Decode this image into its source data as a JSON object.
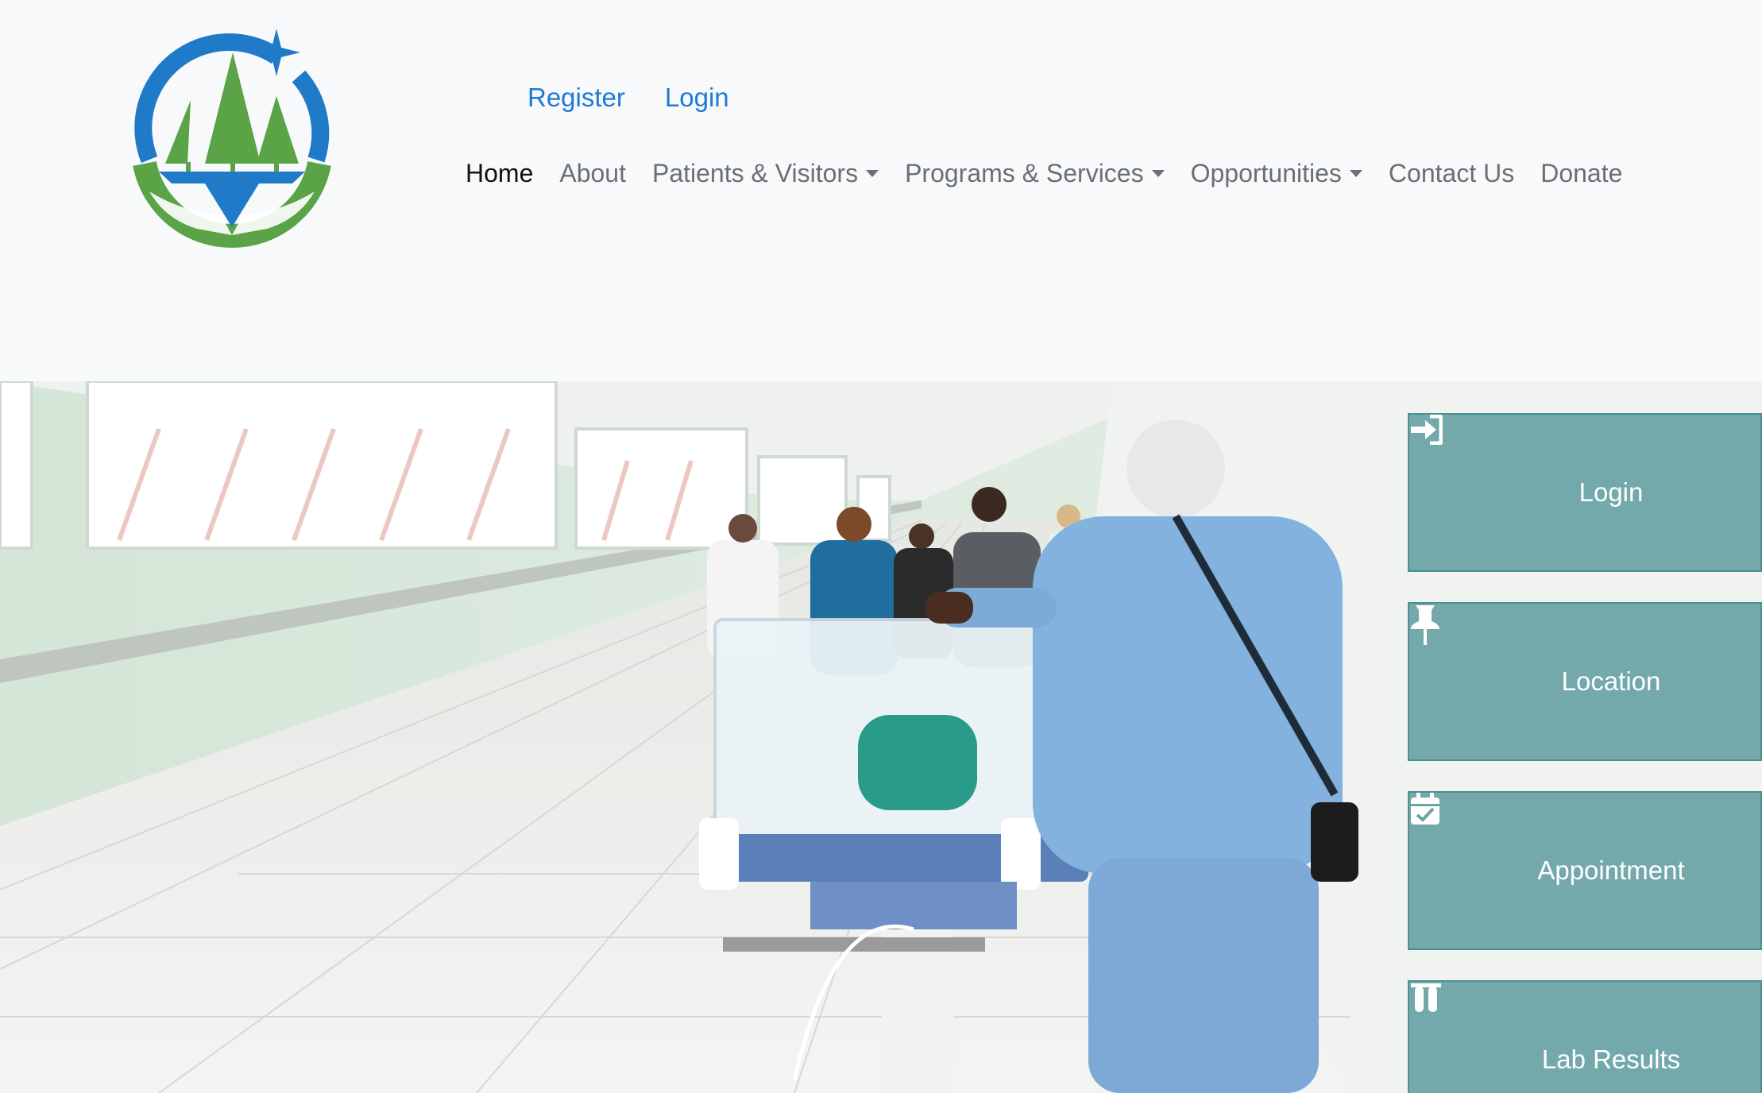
{
  "header": {
    "logo_icon": "hospital-logo",
    "top_links": {
      "register": "Register",
      "login": "Login"
    },
    "nav": {
      "home": "Home",
      "about": "About",
      "patients": "Patients & Visitors",
      "programs": "Programs & Services",
      "opportunities": "Opportunities",
      "contact": "Contact Us",
      "donate": "Donate"
    }
  },
  "hero": {
    "image": "hospital-corridor-nurse-incubator-photo"
  },
  "quick_actions": {
    "login": {
      "label": "Login",
      "icon": "sign-in-icon"
    },
    "location": {
      "label": "Location",
      "icon": "pushpin-icon"
    },
    "appointment": {
      "label": "Appointment",
      "icon": "calendar-check-icon"
    },
    "lab_results": {
      "label": "Lab Results",
      "icon": "test-tubes-icon"
    }
  },
  "colors": {
    "link_blue": "#1f7ad6",
    "nav_gray": "#6b6f73",
    "tile_teal": "#629ea0",
    "logo_blue": "#1f7ac8",
    "logo_green": "#5aa346"
  }
}
